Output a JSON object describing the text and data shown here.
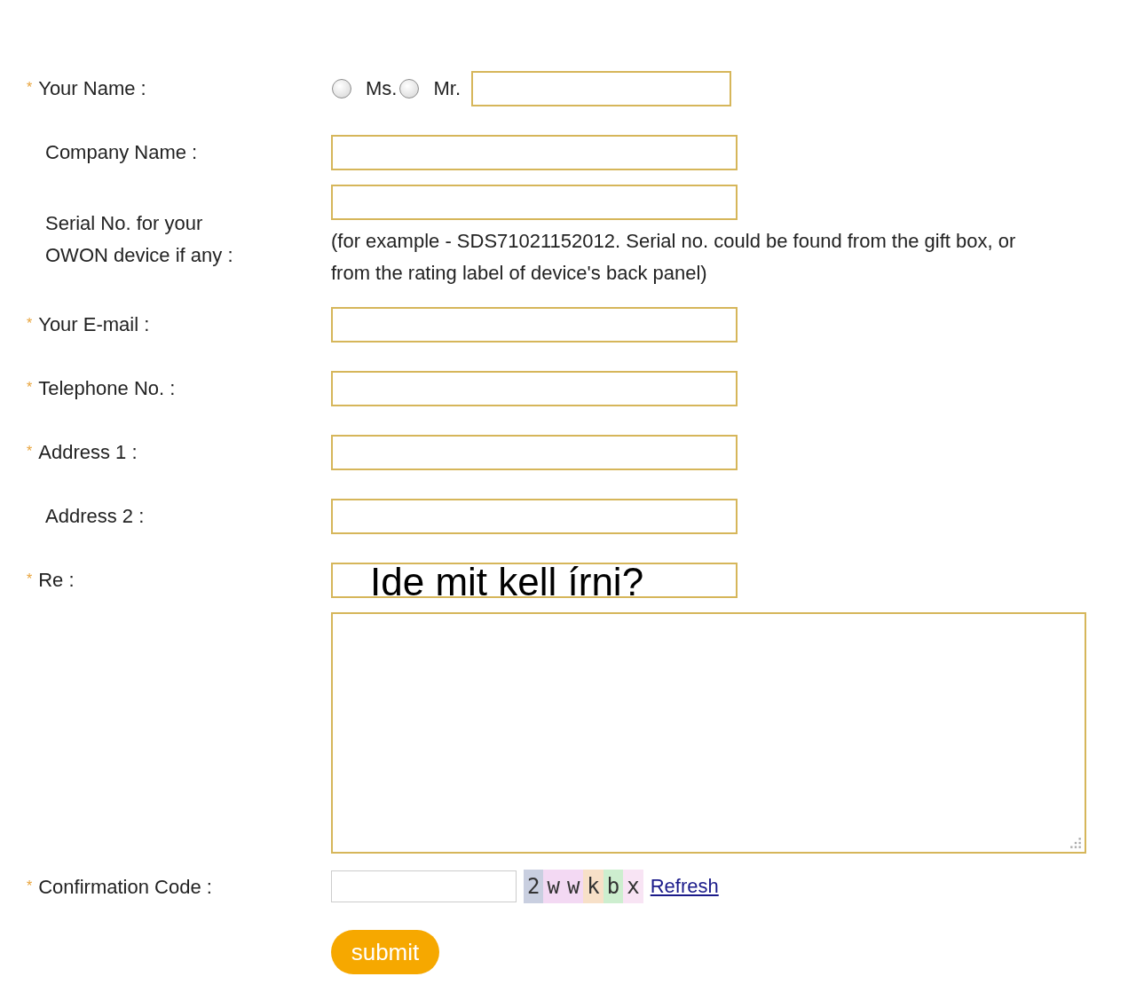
{
  "fields": [
    {
      "kind": "name",
      "label": "Your Name :",
      "marker": "*",
      "options": [
        {
          "label": "Ms.",
          "selected": false
        },
        {
          "label": "Mr.",
          "selected": false
        }
      ]
    },
    {
      "kind": "text",
      "label": "Company Name :"
    },
    {
      "kind": "serial",
      "label": "Serial No. for your OWON device if any :",
      "hint": "(for example - SDS71021152012. Serial no. could be found from the gift box, or from the rating label of device's back panel)"
    },
    {
      "kind": "text",
      "label": "Your E-mail :",
      "marker": "*"
    },
    {
      "kind": "text",
      "label": "Telephone No. :",
      "marker": "*"
    },
    {
      "kind": "text",
      "label": "Address 1 :",
      "marker": "*"
    },
    {
      "kind": "text",
      "label": "Address 2 :"
    },
    {
      "kind": "message",
      "label": "Re :",
      "marker": "*",
      "value": "Ide mit kell írni?"
    },
    {
      "kind": "captcha",
      "label": "Confirmation Code :",
      "marker": "*",
      "captcha": [
        {
          "char": "2",
          "color": "#c9cfe0"
        },
        {
          "char": "w",
          "color": "#f3d9f3"
        },
        {
          "char": "w",
          "color": "#f3d9f3"
        },
        {
          "char": "k",
          "color": "#f7e0c8"
        },
        {
          "char": "b",
          "color": "#cdeecf"
        },
        {
          "char": "x",
          "color": "#f8e4f4"
        }
      ],
      "link": "Refresh"
    }
  ],
  "submit": "submit"
}
